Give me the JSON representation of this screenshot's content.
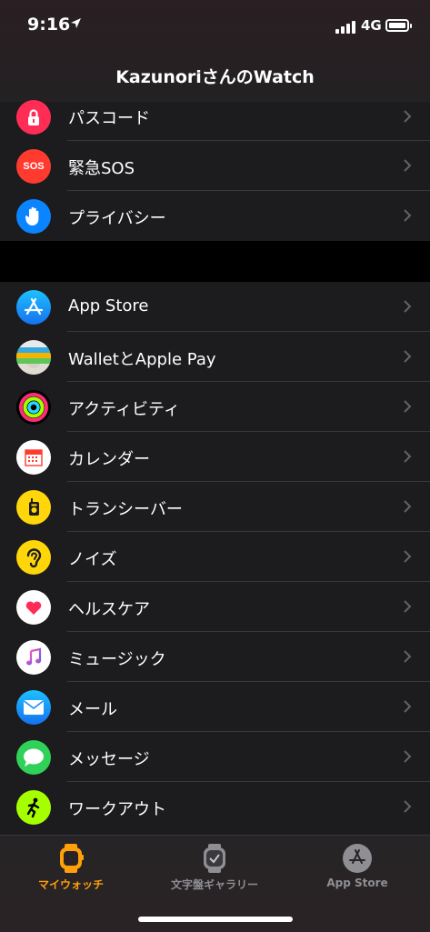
{
  "status": {
    "time": "9:16",
    "network": "4G"
  },
  "header": {
    "title": "KazunoriさんのWatch"
  },
  "list": [
    {
      "label": "パスコード",
      "icon": "lock-icon",
      "color": "#ff2d55"
    },
    {
      "label": "緊急SOS",
      "icon": "sos-icon",
      "color": "#ff3b30",
      "icon_text": "SOS"
    },
    {
      "label": "プライバシー",
      "icon": "hand-icon",
      "color": "#0a84ff"
    },
    {
      "label": "App Store",
      "icon": "app-store-icon",
      "color": "#1a9bf7"
    },
    {
      "label": "WalletとApple Pay",
      "icon": "wallet-icon",
      "color": "#3a3a3c"
    },
    {
      "label": "アクティビティ",
      "icon": "activity-rings-icon",
      "color": "#000000"
    },
    {
      "label": "カレンダー",
      "icon": "calendar-icon",
      "color": "#ffffff"
    },
    {
      "label": "トランシーバー",
      "icon": "walkie-talkie-icon",
      "color": "#ffd60a"
    },
    {
      "label": "ノイズ",
      "icon": "ear-icon",
      "color": "#ffd60a"
    },
    {
      "label": "ヘルスケア",
      "icon": "heart-icon",
      "color": "#ffffff"
    },
    {
      "label": "ミュージック",
      "icon": "music-note-icon",
      "color": "#ffffff"
    },
    {
      "label": "メール",
      "icon": "envelope-icon",
      "color": "#1a8cff"
    },
    {
      "label": "メッセージ",
      "icon": "speech-bubble-icon",
      "color": "#30d158"
    },
    {
      "label": "ワークアウト",
      "icon": "running-figure-icon",
      "color": "#a6ff00"
    }
  ],
  "tabs": [
    {
      "label": "マイウォッチ",
      "icon": "watch-icon",
      "active": true
    },
    {
      "label": "文字盤ギャラリー",
      "icon": "watch-face-gallery-icon",
      "active": false
    },
    {
      "label": "App Store",
      "icon": "app-store-tab-icon",
      "active": false
    }
  ],
  "colors": {
    "accent": "#ff9f0a",
    "background": "#1c1c1e",
    "separator": "#38383a"
  }
}
